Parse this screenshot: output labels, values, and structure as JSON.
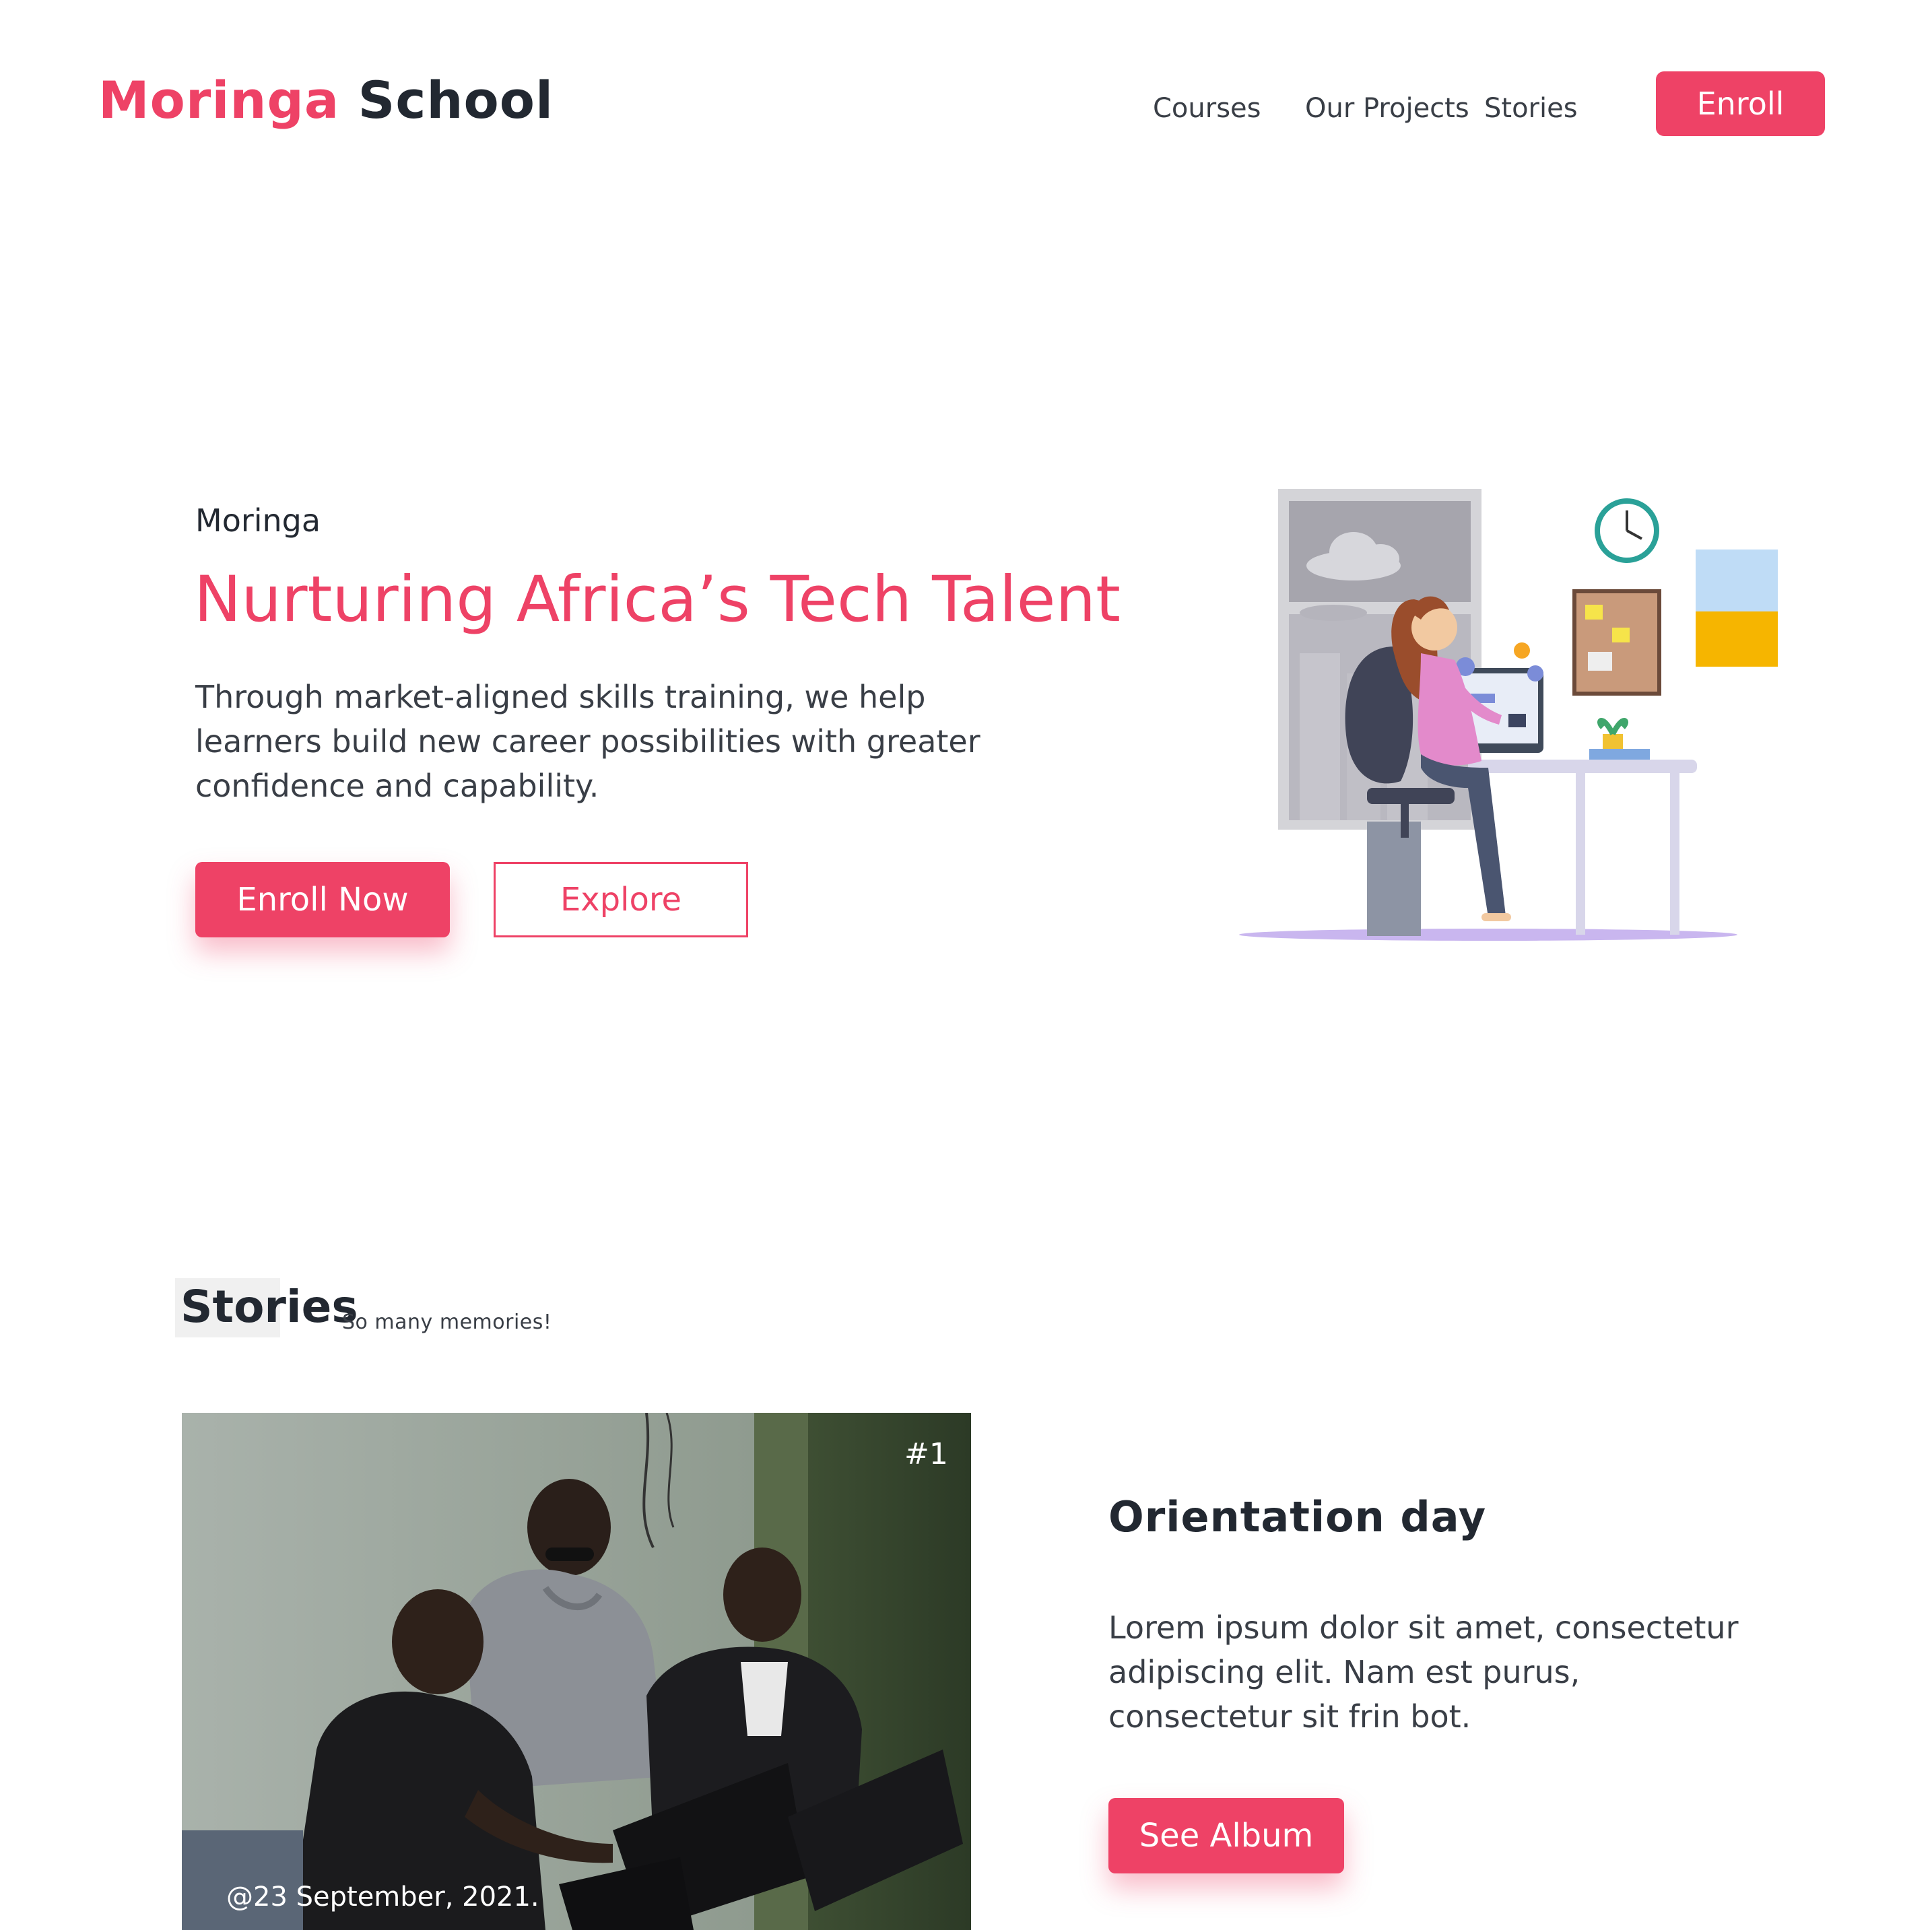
{
  "header": {
    "logo_brand": "Moringa",
    "logo_rest": "School",
    "nav": [
      {
        "label": "Courses"
      },
      {
        "label": "Our Projects"
      },
      {
        "label": "Stories"
      }
    ],
    "enroll_label": "Enroll"
  },
  "hero": {
    "eyebrow": "Moringa",
    "title": "Nurturing Africa’s Tech Talent",
    "description": "Through market-aligned skills training, we help learners build new career possibilities with greater confidence and capability.",
    "primary_button": "Enroll Now",
    "secondary_button": "Explore",
    "illustration_icon": "woman-coding-at-desk-illustration"
  },
  "stories": {
    "heading": "Stories",
    "subheading": "So many memories!",
    "items": [
      {
        "number": "#1",
        "date": "@23 September, 2021.",
        "title": "Orientation day",
        "text": "Lorem ipsum dolor sit amet, consectetur adipiscing elit. Nam est purus, consectetur sit frin bot.",
        "button": "See Album",
        "photo_icon": "students-with-laptops-photo"
      }
    ]
  },
  "colors": {
    "accent": "#ee4266",
    "text_dark": "#222831",
    "text_body": "#393e46"
  }
}
